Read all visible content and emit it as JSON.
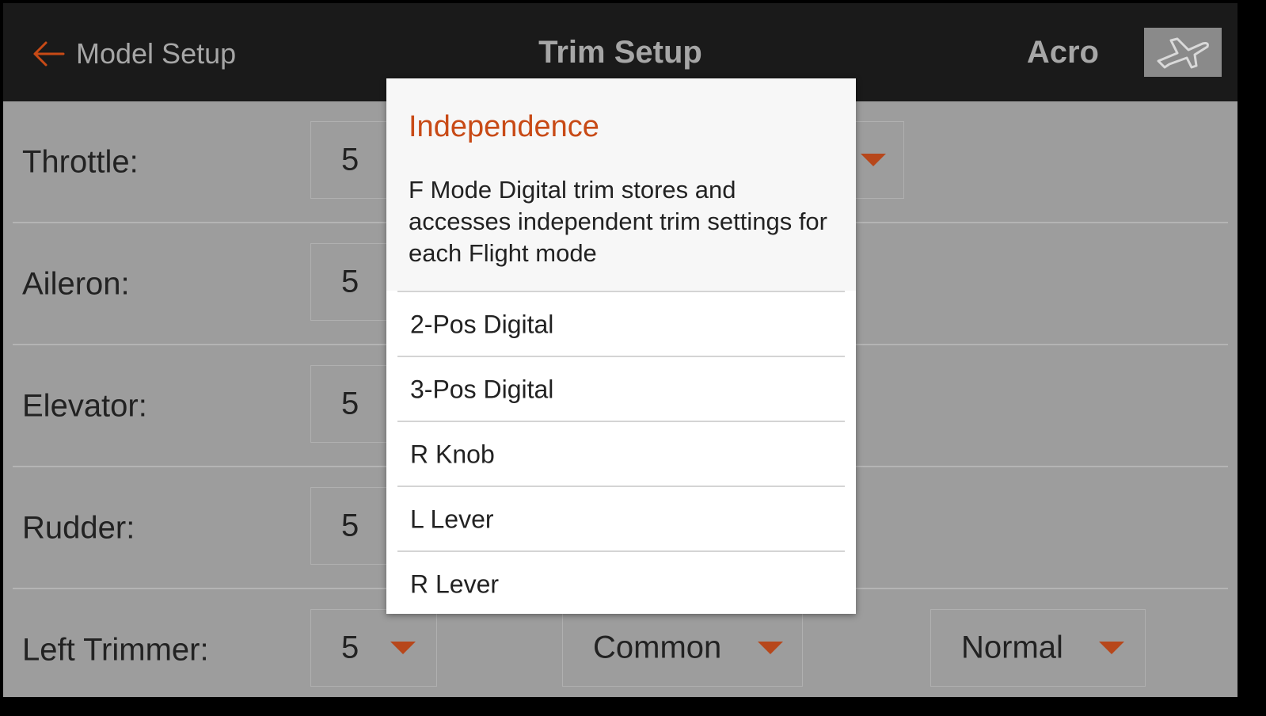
{
  "header": {
    "back_label": "Model Setup",
    "title": "Trim Setup",
    "model_type": "Acro",
    "back_icon": "left-arrow-icon",
    "model_icon": "airplane-icon"
  },
  "colors": {
    "accent": "#c84a16",
    "header_bg": "#1a1a1a",
    "background": "#9d9d9d"
  },
  "rows": [
    {
      "label": "Throttle:",
      "step": "5"
    },
    {
      "label": "Aileron:",
      "step": "5"
    },
    {
      "label": "Elevator:",
      "step": "5"
    },
    {
      "label": "Rudder:",
      "step": "5"
    },
    {
      "label": "Left Trimmer:",
      "step": "5",
      "mode": "Common",
      "direction": "Normal"
    }
  ],
  "modal": {
    "title": "Independence",
    "description": "F Mode Digital trim stores and accesses independent trim settings for each Flight mode",
    "options": [
      "2-Pos Digital",
      "3-Pos Digital",
      "R Knob",
      "L Lever",
      "R Lever"
    ]
  }
}
